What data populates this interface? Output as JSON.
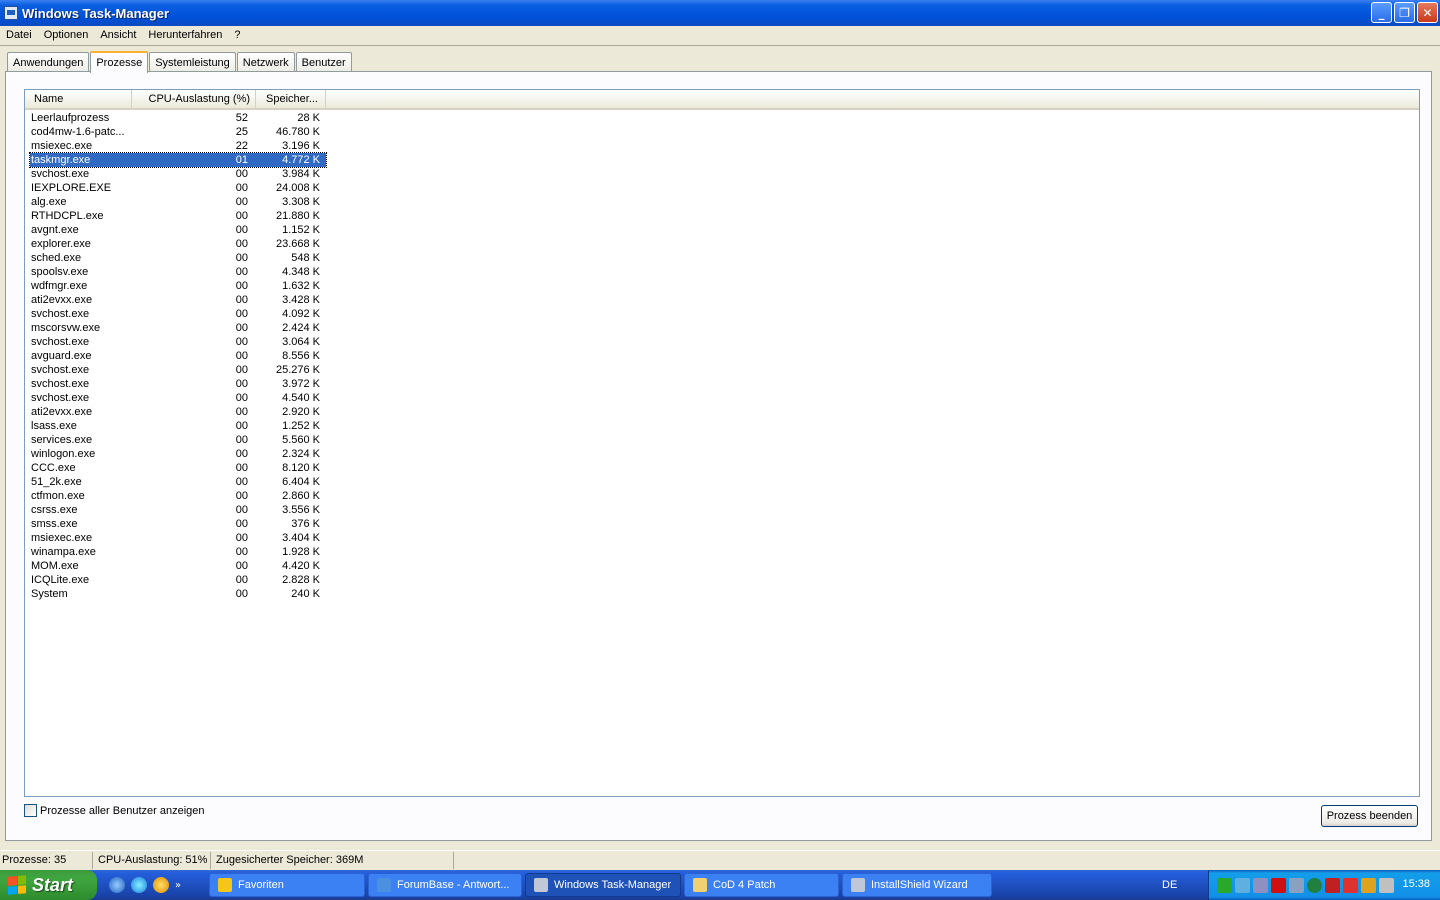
{
  "window": {
    "title": "Windows Task-Manager",
    "minimize": "_",
    "restore": "❐",
    "close": "✕"
  },
  "menu": [
    "Datei",
    "Optionen",
    "Ansicht",
    "Herunterfahren",
    "?"
  ],
  "tabs": [
    "Anwendungen",
    "Prozesse",
    "Systemleistung",
    "Netzwerk",
    "Benutzer"
  ],
  "active_tab": "Prozesse",
  "columns": {
    "name": "Name",
    "cpu": "CPU-Auslastung (%)",
    "mem": "Speicher..."
  },
  "processes": [
    {
      "name": "Leerlaufprozess",
      "cpu": "52",
      "mem": "28 K"
    },
    {
      "name": "cod4mw-1.6-patc...",
      "cpu": "25",
      "mem": "46.780 K"
    },
    {
      "name": "msiexec.exe",
      "cpu": "22",
      "mem": "3.196 K"
    },
    {
      "name": "taskmgr.exe",
      "cpu": "01",
      "mem": "4.772 K",
      "selected": true
    },
    {
      "name": "svchost.exe",
      "cpu": "00",
      "mem": "3.984 K"
    },
    {
      "name": "IEXPLORE.EXE",
      "cpu": "00",
      "mem": "24.008 K"
    },
    {
      "name": "alg.exe",
      "cpu": "00",
      "mem": "3.308 K"
    },
    {
      "name": "RTHDCPL.exe",
      "cpu": "00",
      "mem": "21.880 K"
    },
    {
      "name": "avgnt.exe",
      "cpu": "00",
      "mem": "1.152 K"
    },
    {
      "name": "explorer.exe",
      "cpu": "00",
      "mem": "23.668 K"
    },
    {
      "name": "sched.exe",
      "cpu": "00",
      "mem": "548 K"
    },
    {
      "name": "spoolsv.exe",
      "cpu": "00",
      "mem": "4.348 K"
    },
    {
      "name": "wdfmgr.exe",
      "cpu": "00",
      "mem": "1.632 K"
    },
    {
      "name": "ati2evxx.exe",
      "cpu": "00",
      "mem": "3.428 K"
    },
    {
      "name": "svchost.exe",
      "cpu": "00",
      "mem": "4.092 K"
    },
    {
      "name": "mscorsvw.exe",
      "cpu": "00",
      "mem": "2.424 K"
    },
    {
      "name": "svchost.exe",
      "cpu": "00",
      "mem": "3.064 K"
    },
    {
      "name": "avguard.exe",
      "cpu": "00",
      "mem": "8.556 K"
    },
    {
      "name": "svchost.exe",
      "cpu": "00",
      "mem": "25.276 K"
    },
    {
      "name": "svchost.exe",
      "cpu": "00",
      "mem": "3.972 K"
    },
    {
      "name": "svchost.exe",
      "cpu": "00",
      "mem": "4.540 K"
    },
    {
      "name": "ati2evxx.exe",
      "cpu": "00",
      "mem": "2.920 K"
    },
    {
      "name": "lsass.exe",
      "cpu": "00",
      "mem": "1.252 K"
    },
    {
      "name": "services.exe",
      "cpu": "00",
      "mem": "5.560 K"
    },
    {
      "name": "winlogon.exe",
      "cpu": "00",
      "mem": "2.324 K"
    },
    {
      "name": "CCC.exe",
      "cpu": "00",
      "mem": "8.120 K"
    },
    {
      "name": "51_2k.exe",
      "cpu": "00",
      "mem": "6.404 K"
    },
    {
      "name": "ctfmon.exe",
      "cpu": "00",
      "mem": "2.860 K"
    },
    {
      "name": "csrss.exe",
      "cpu": "00",
      "mem": "3.556 K"
    },
    {
      "name": "smss.exe",
      "cpu": "00",
      "mem": "376 K"
    },
    {
      "name": "msiexec.exe",
      "cpu": "00",
      "mem": "3.404 K"
    },
    {
      "name": "winampa.exe",
      "cpu": "00",
      "mem": "1.928 K"
    },
    {
      "name": "MOM.exe",
      "cpu": "00",
      "mem": "4.420 K"
    },
    {
      "name": "ICQLite.exe",
      "cpu": "00",
      "mem": "2.828 K"
    },
    {
      "name": "System",
      "cpu": "00",
      "mem": "240 K"
    }
  ],
  "show_all_users_label": "Prozesse aller Benutzer anzeigen",
  "end_process_label": "Prozess beenden",
  "status": {
    "processes": "Prozesse: 35",
    "cpu": "CPU-Auslastung: 51%",
    "commit": "Zugesicherter Speicher: 369M"
  },
  "taskbar": {
    "start": "Start",
    "tasks": [
      {
        "label": "Favoriten",
        "icon": "star-icon",
        "color": "#f5c518"
      },
      {
        "label": "ForumBase - Antwort...",
        "icon": "ie-icon",
        "color": "#4a8fe0"
      },
      {
        "label": "Windows Task-Manager",
        "icon": "taskmgr-icon",
        "color": "#c0c8d8",
        "active": true
      },
      {
        "label": "CoD 4 Patch",
        "icon": "folder-icon",
        "color": "#f0d070"
      },
      {
        "label": "InstallShield Wizard",
        "icon": "installer-icon",
        "color": "#c0c8d8"
      }
    ],
    "language": "DE",
    "clock": "15:38"
  },
  "colors": {
    "title_blue": "#0050d8",
    "selection": "#316ac5",
    "start_green": "#3fa63f"
  }
}
